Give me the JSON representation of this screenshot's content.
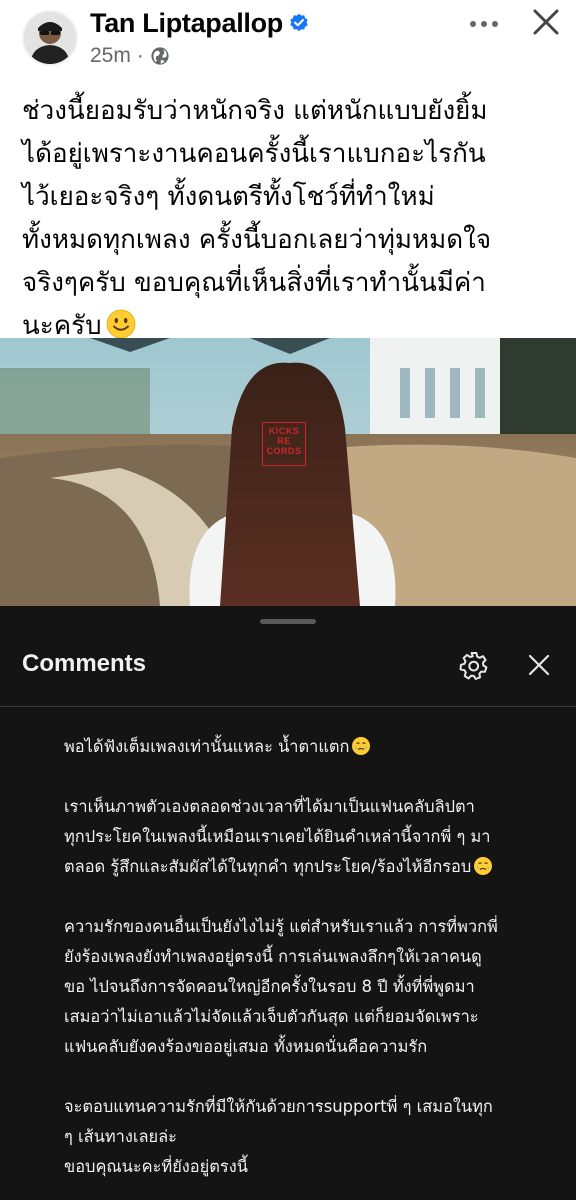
{
  "post": {
    "author_name": "Tan Liptapallop",
    "timestamp": "25m",
    "meta_separator": "·",
    "text": "ช่วงนี้ยอมรับว่าหนักจริง แต่หนักแบบยังยิ้ม\nได้อยู่เพราะงานคอนครั้งนี้เราแบกอะไรกัน\nไว้เยอะจริงๆ ทั้งดนตรีทั้งโชว์ที่ทำใหม่\nทั้งหมดทุกเพลง ครั้งนี้บอกเลยว่าทุ่มหมดใจ\nจริงๆครับ ขอบคุณที่เห็นสิ่งที่เราทำนั้นมีค่า\nนะครับ",
    "icons": {
      "verified": "verified-badge-icon",
      "privacy": "globe-icon",
      "more": "more-dots-icon",
      "close": "close-icon",
      "text_emoji": "smiling-face-emoji"
    }
  },
  "media": {
    "watermark": [
      "KICKS",
      "RE",
      "CORDS"
    ]
  },
  "comments_sheet": {
    "title": "Comments",
    "icons": {
      "settings": "gear-icon",
      "close": "close-icon",
      "emoji": "face-holding-back-tears-emoji"
    },
    "comment_paragraphs": [
      "พอได้ฟังเต็มเพลงเท่านั้นแหละ น้ำตาแตก",
      "เราเห็นภาพตัวเองตลอดช่วงเวลาที่ได้มาเป็นแฟนคลับลิปตา\nทุกประโยคในเพลงนี้เหมือนเราเคยได้ยินคำเหล่านี้จากพี่ ๆ มา\nตลอด รู้สึกและสัมผัสได้ในทุกคำ ทุกประโยค/ร้องไห้อีกรอบ",
      "ความรักของคนอื่นเป็นยังไงไม่รู้ แต่สำหรับเราแล้ว การที่พวกพี่\nยังร้องเพลงยังทำเพลงอยู่ตรงนี้ การเล่นเพลงลึกๆให้เวลาคนดู\nขอ ไปจนถึงการจัดคอนใหญ่อีกครั้งในรอบ 8 ปี ทั้งที่พี่พูดมา\nเสมอว่าไม่เอาแล้วไม่จัดแล้วเจ็บตัวกันสุด แต่ก็ยอมจัดเพราะ\nแฟนคลับยังคงร้องขออยู่เสมอ ทั้งหมดนั่นคือความรัก",
      "จะตอบแทนความรักที่มีให้กันด้วยการsupportพี่ ๆ เสมอในทุก\nๆ เส้นทางเลยล่ะ\nขอบคุณนะคะที่ยังอยู่ตรงนี้"
    ]
  },
  "colors": {
    "verified_blue": "#1877f2",
    "sheet_background": "#141414",
    "secondary_text": "#65676b"
  }
}
